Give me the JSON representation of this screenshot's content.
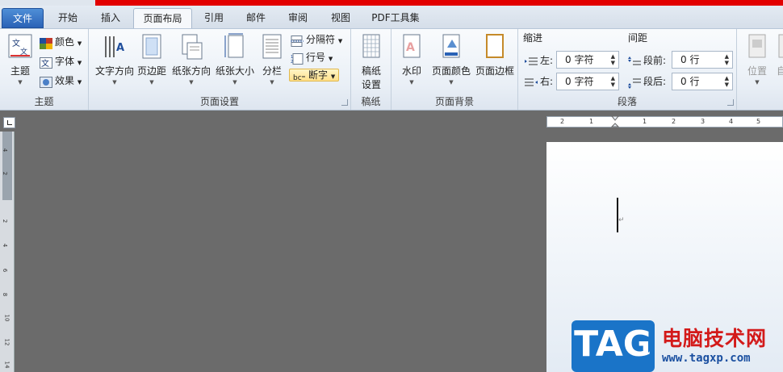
{
  "tabs": [
    {
      "label": "文件"
    },
    {
      "label": "开始"
    },
    {
      "label": "插入"
    },
    {
      "label": "页面布局"
    },
    {
      "label": "引用"
    },
    {
      "label": "邮件"
    },
    {
      "label": "审阅"
    },
    {
      "label": "视图"
    },
    {
      "label": "PDF工具集"
    }
  ],
  "ribbon": {
    "theme": {
      "title": "主题",
      "main": "主题",
      "colors": "颜色",
      "fonts": "字体",
      "effects": "效果"
    },
    "page_setup": {
      "title": "页面设置",
      "text_direction": "文字方向",
      "margins": "页边距",
      "orientation": "纸张方向",
      "size": "纸张大小",
      "columns": "分栏",
      "breaks": "分隔符",
      "line_numbers": "行号",
      "hyphenation": "断字"
    },
    "draft_paper": {
      "title": "稿纸",
      "line1": "稿纸",
      "line2": "设置"
    },
    "page_background": {
      "title": "页面背景",
      "watermark": "水印",
      "page_color": "页面颜色",
      "page_borders": "页面边框"
    },
    "paragraph": {
      "title": "段落",
      "indent_label": "缩进",
      "spacing_label": "间距",
      "left_label": "左:",
      "left_value": "0 字符",
      "right_label": "右:",
      "right_value": "0 字符",
      "before_label": "段前:",
      "before_value": "0 行",
      "after_label": "段后:",
      "after_value": "0 行"
    },
    "arrange": {
      "position": "位置",
      "auto": "自"
    }
  },
  "hruler_numbers": [
    "2",
    "1",
    "1",
    "2",
    "3",
    "4",
    "5"
  ],
  "vruler_numbers": [
    "4",
    "2",
    "2",
    "4",
    "6",
    "8",
    "10",
    "12",
    "14"
  ],
  "watermark": {
    "badge": "TAG",
    "title": "电脑技术网",
    "url": "www.tagxp.com"
  },
  "colors": {
    "accent": "#2a62b6",
    "redbar": "#e20000",
    "badge": "#1a74c8"
  }
}
